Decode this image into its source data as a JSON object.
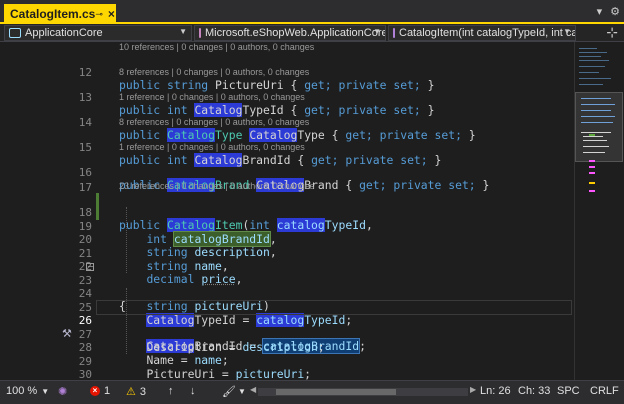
{
  "tab": {
    "title": "CatalogItem.cs",
    "pin_icon": "⊸",
    "close_icon": "×"
  },
  "tabbar": {
    "overflow_icon": "▾",
    "settings_icon": "⚙"
  },
  "navbar": {
    "project": "ApplicationCore",
    "type": "Microsoft.eShopWeb.ApplicationCore.",
    "member": "CatalogItem(int catalogTypeId, int cata"
  },
  "code": {
    "lens": {
      "l12": "10 references | 0 changes | 0 authors, 0 changes",
      "l13": "8 references | 0 changes | 0 authors, 0 changes",
      "l14": "1 reference | 0 changes | 0 authors, 0 changes",
      "l15": "8 references | 0 changes | 0 authors, 0 changes",
      "l16": "1 reference | 0 changes | 0 authors, 0 changes",
      "l18": "23 references | 0 changes | 0 authors, 0 changes"
    },
    "line_numbers": [
      "12",
      "13",
      "14",
      "15",
      "16",
      "17",
      "18",
      "19",
      "20",
      "21",
      "22",
      "23",
      "24",
      "25",
      "26",
      "27",
      "28",
      "29",
      "30",
      "31"
    ],
    "tokens": {
      "public": "public",
      "string": "string",
      "int": "int",
      "decimal": "decimal",
      "get": "get;",
      "private_set": "private set;",
      "brace_open": "{",
      "brace_close": "}",
      "brace_open_sp": "{ ",
      "brace_close_sp": " }",
      "PictureUri": "PictureUri",
      "Catalog": "Catalog",
      "TypeId": "TypeId",
      "BrandId": "BrandId",
      "CatalogType": "CatalogType",
      "CatalogBrand": "CatalogBrand",
      "Item": "Item",
      "catalog": "catalog",
      "catalogBrandId": "catalogBrandId",
      "description": "description",
      "name": "name",
      "price": "price",
      "pictureUri": "pictureUri",
      "Description": "Description",
      "Name": "Name",
      "PictureUri2": "PictureUri",
      "catalog_l": "catalog",
      "randId": "randId",
      "ypeId": "ypeId",
      "comma": ",",
      "semicolon": ";",
      "paren_open": "(",
      "paren_close": ")",
      "assign": " = ",
      "sp": " ",
      "B": "B",
      "T": "T"
    }
  },
  "status": {
    "zoom": "100 %",
    "errors": "1",
    "warnings": "3",
    "ln": "Ln: 26",
    "ch": "Ch: 33",
    "encoding": "SPC",
    "line_ending": "CRLF"
  },
  "colors": {
    "accent_tab": "#ffd700",
    "keyword": "#569cd6",
    "type": "#4ec9b0",
    "identifier": "#9cdcfe",
    "highlight": "#2c3ad6"
  }
}
